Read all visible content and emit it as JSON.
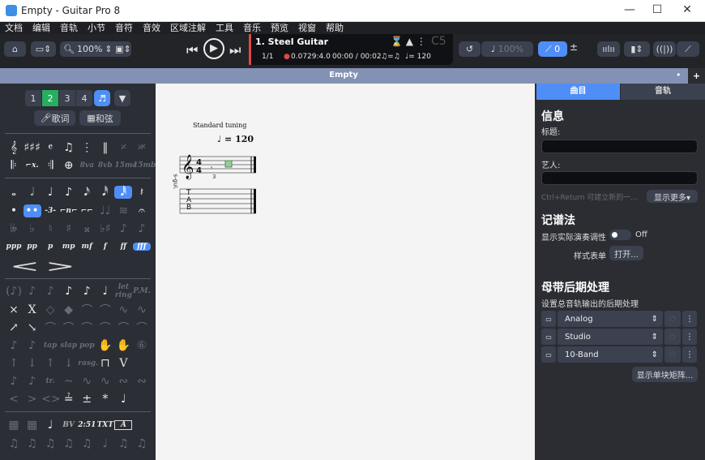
{
  "window": {
    "title": "Empty - Guitar Pro 8",
    "minimize": "—",
    "maximize": "☐",
    "close": "✕"
  },
  "menu": [
    "文档",
    "编辑",
    "音轨",
    "小节",
    "音符",
    "音效",
    "区域注解",
    "工具",
    "音乐",
    "预览",
    "视窗",
    "帮助"
  ],
  "toolbar": {
    "zoom": "100%",
    "track_name": "1. Steel Guitar",
    "bar": "1/1",
    "position": "0.0729:4.0",
    "time": "00:00 / 00:02",
    "swing": "♫=♫",
    "tempo": "♩= 120",
    "key": "C5",
    "speed": "100%",
    "tuning_value": "0"
  },
  "tab": {
    "title": "Empty"
  },
  "left": {
    "voices": [
      "1",
      "2",
      "3",
      "4"
    ],
    "lyrics": "歌词",
    "chords": "和弦",
    "row1": [
      "𝄞",
      "♯♯♯",
      "𝄴",
      "♫",
      "⋮",
      "‖",
      "𝄎",
      "𝄏"
    ],
    "row2": [
      "𝄆",
      "⌐x.",
      "𝄇",
      "⊕",
      "8va",
      "8vb",
      "15ma",
      "15mb"
    ],
    "row3": [
      "𝅝",
      "𝅗𝅥",
      "♩",
      "♪",
      "𝅘𝅥𝅯",
      "𝅘𝅥𝅰",
      "𝅘𝅥𝅱",
      "𝄽"
    ],
    "row4": [
      "•",
      "••",
      "-3-",
      "⌐n⌐",
      "⌐⌐",
      "♩♩",
      "≋",
      "𝄐"
    ],
    "row5": [
      "𝄫",
      "♭",
      "♮",
      "♯",
      "𝄪",
      "♭♯",
      "♪",
      "♪"
    ],
    "dynamics": [
      "ppp",
      "pp",
      "p",
      "mp",
      "mf",
      "f",
      "ff",
      "fff"
    ],
    "hairpins": [
      "<",
      ">"
    ],
    "row6": [
      "(♪)",
      "♪",
      "♪",
      "♪",
      "♪",
      "♩",
      "let ring",
      "P.M."
    ],
    "row7": [
      "×",
      "X",
      "◇",
      "◆",
      "⌒",
      "⌒",
      "∿",
      "∿"
    ],
    "row8": [
      "↗",
      "↘",
      "⌒",
      "⌒",
      "⌒",
      "⌒",
      "⌒",
      "⌒"
    ],
    "row9": [
      "♪",
      "♪",
      "tap",
      "slap",
      "pop",
      "✋",
      "✋",
      "⑥"
    ],
    "row10": [
      "↑",
      "↓",
      "↑",
      "↓",
      "rasg.",
      "⊓",
      "V",
      ""
    ],
    "row11": [
      "♪",
      "♪",
      "tr.",
      "~",
      "∿",
      "∿",
      "∾",
      "∾"
    ],
    "row12": [
      "<",
      ">",
      "<>",
      "≟",
      "±",
      "*",
      "♩",
      ""
    ],
    "row13": [
      "▦",
      "▦",
      "♩",
      "BV",
      "2:51",
      "TXT",
      "A",
      ""
    ],
    "row14": [
      "♫",
      "♫",
      "♫",
      "♫",
      "♫",
      "♩",
      "♫",
      "♫"
    ]
  },
  "score": {
    "tuning": "Standard tuning",
    "tempo": "♩ = 120",
    "track_label": "s-gui.",
    "tab_letters": [
      "T",
      "A",
      "B"
    ]
  },
  "right": {
    "tabs": [
      "曲目",
      "音轨"
    ],
    "info_heading": "信息",
    "title_label": "标题:",
    "title_value": "",
    "artist_label": "艺人:",
    "artist_value": "",
    "hint": "Ctrl+Return 可建立新的一...",
    "show_more": "显示更多▾",
    "notation_heading": "记谱法",
    "transpose_label": "显示实际演奏调性",
    "transpose_state": "Off",
    "stylesheet_label": "样式表单",
    "open_button": "打开...",
    "master_heading": "母带后期处理",
    "master_desc": "设置总音轨输出的后期处理",
    "effects": [
      "Analog",
      "Studio",
      "10-Band"
    ],
    "matrix_button": "显示单块矩阵..."
  },
  "colors": {
    "accent": "#4f8ef7",
    "voice_active": "#27ae60",
    "tabbar": "#8391b4"
  }
}
